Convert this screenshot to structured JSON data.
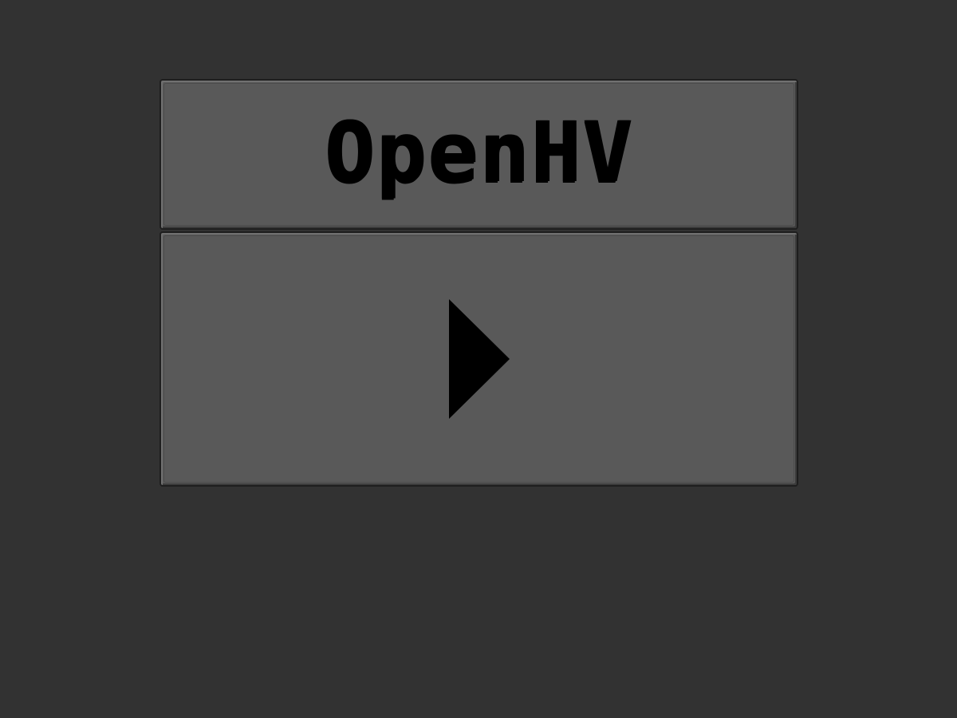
{
  "title": {
    "text": "OpenHV"
  },
  "play_button": {
    "icon": "play-icon"
  },
  "colors": {
    "background": "#323232",
    "panel": "#595959",
    "panel_border": "#1e1e1e",
    "text": "#000000"
  }
}
